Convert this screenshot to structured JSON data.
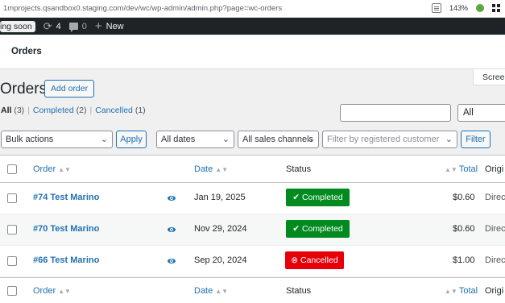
{
  "browser": {
    "url": "1mprojects.qsandbox0.staging.com/dev/wc/wp-admin/admin.php?page=wc-orders",
    "zoom": "143%"
  },
  "adminbar": {
    "coming_soon": "ing soon",
    "updates_count": "4",
    "comments_count": "0",
    "new_label": "New"
  },
  "header": {
    "title": "Orders"
  },
  "screen_options": "Screen",
  "page": {
    "title": "Orders",
    "add_order": "Add order"
  },
  "views": [
    {
      "label": "All",
      "count": "(3)"
    },
    {
      "label": "Completed",
      "count": "(2)"
    },
    {
      "label": "Cancelled",
      "count": "(1)"
    }
  ],
  "status_filter": "All",
  "filters": {
    "bulk_actions": "Bulk actions",
    "apply": "Apply",
    "dates": "All dates",
    "channels": "All sales channels",
    "customer_placeholder": "Filter by registered customer",
    "filter": "Filter"
  },
  "table": {
    "columns": {
      "order": "Order",
      "date": "Date",
      "status": "Status",
      "total": "Total",
      "origin": "Origi"
    },
    "rows": [
      {
        "order": "#74 Test Marino",
        "date": "Jan 19, 2025",
        "status": "Completed",
        "status_icon": "check-icon",
        "total": "$0.60",
        "origin": "Direct"
      },
      {
        "order": "#70 Test Marino",
        "date": "Nov 29, 2024",
        "status": "Completed",
        "status_icon": "check-icon",
        "total": "$0.60",
        "origin": "Direct"
      },
      {
        "order": "#66 Test Marino",
        "date": "Sep 20, 2024",
        "status": "Cancelled",
        "status_icon": "x-circle-icon",
        "total": "$1.00",
        "origin": "Direct"
      }
    ]
  },
  "colors": {
    "completed": "#008a20",
    "cancelled": "#e6000a",
    "link": "#2271b1",
    "adminbar": "#1d2327"
  }
}
